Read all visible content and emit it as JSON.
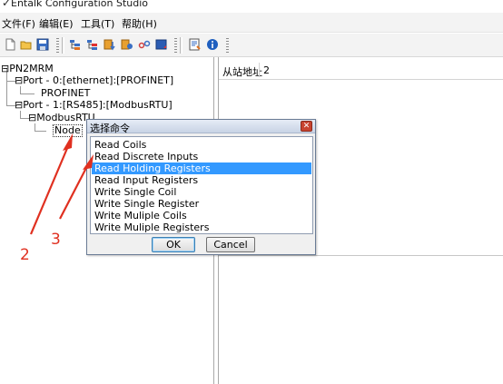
{
  "window": {
    "title": "Entalk Configuration Studio"
  },
  "menu": [
    {
      "label": "文件(F)"
    },
    {
      "label": "编辑(E)"
    },
    {
      "label": "工具(T)"
    },
    {
      "label": "帮助(H)"
    }
  ],
  "toolbar": {
    "icons": [
      "new-file-icon",
      "open-folder-icon",
      "save-icon",
      "add-port-icon",
      "add-module-icon",
      "download-icon",
      "settings-icon",
      "link-icon",
      "upload-icon",
      "report-icon",
      "info-icon"
    ]
  },
  "tree": {
    "root": "PN2MRM",
    "port0": "Port - 0:[ethernet]:[PROFINET]",
    "profinet": "PROFINET",
    "port1": "Port - 1:[RS485]:[ModbusRTU]",
    "modbusrtu": "ModbusRTU",
    "node": "Node"
  },
  "properties": {
    "label": "从站地址",
    "value": "2"
  },
  "dialog": {
    "title": "选择命令",
    "close_symbol": "✕",
    "commands": [
      "Read Coils",
      "Read Discrete Inputs",
      "Read Holding Registers",
      "Read Input Registers",
      "Write Single Coil",
      "Write Single Register",
      "Write Muliple Coils",
      "Write Muliple Registers"
    ],
    "selected_index": 2,
    "ok_label": "OK",
    "cancel_label": "Cancel"
  },
  "annotations": [
    {
      "label": "2"
    },
    {
      "label": "3"
    }
  ],
  "colors": {
    "selection": "#3399ff",
    "annotation": "#e03020",
    "dialog_close": "#c8432f"
  }
}
